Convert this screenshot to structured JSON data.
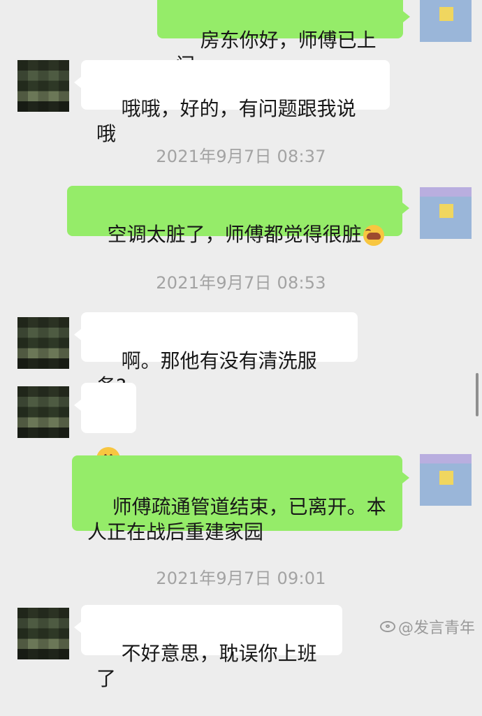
{
  "messages": {
    "m1": "房东你好，师傅已上门",
    "m2": "哦哦，好的，有问题跟我说哦",
    "m3": "空调太脏了，师傅都觉得很脏",
    "m4": "啊。那他有没有清洗服务?",
    "m5": "师傅疏通管道结束，已离开。本\n人正在战后重建家园",
    "m6": "不好意思，耽误你上班了"
  },
  "timestamps": {
    "t1": "2021年9月7日 08:37",
    "t2": "2021年9月7日 08:53",
    "t3": "2021年9月7日 09:01"
  },
  "emojis": {
    "m3_tail": "face-with-tears-icon",
    "m_emoji": "astonished-face-icon"
  },
  "watermark": {
    "text": "@发言青年"
  }
}
